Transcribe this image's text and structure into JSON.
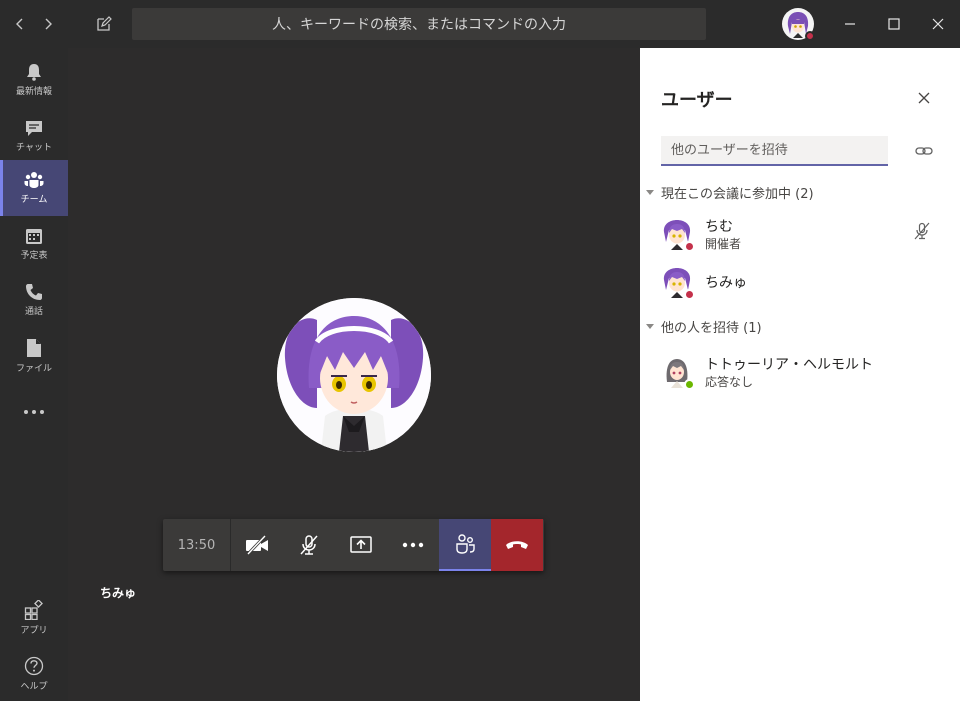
{
  "titlebar": {
    "search_placeholder": "人、キーワードの検索、またはコマンドの入力"
  },
  "rail": {
    "items": [
      {
        "label": "最新情報",
        "icon": "bell-icon"
      },
      {
        "label": "チャット",
        "icon": "chat-icon"
      },
      {
        "label": "チーム",
        "icon": "teams-icon",
        "active": true
      },
      {
        "label": "予定表",
        "icon": "calendar-icon"
      },
      {
        "label": "通話",
        "icon": "phone-icon"
      },
      {
        "label": "ファイル",
        "icon": "file-icon"
      },
      {
        "label": "",
        "icon": "more-icon"
      }
    ],
    "bottom": [
      {
        "label": "アプリ",
        "icon": "apps-icon"
      },
      {
        "label": "ヘルプ",
        "icon": "help-icon"
      }
    ]
  },
  "call": {
    "timer": "13:50",
    "caller_name": "ちみゅ"
  },
  "panel": {
    "title": "ユーザー",
    "invite_placeholder": "他のユーザーを招待",
    "in_meeting_header": "現在この会議に参加中 (2)",
    "invited_header": "他の人を招待 (1)",
    "participants": [
      {
        "name": "ちむ",
        "role": "開催者",
        "status_color": "#c4314b",
        "muted": true
      },
      {
        "name": "ちみゅ",
        "role": "",
        "status_color": "#c4314b",
        "muted": false
      }
    ],
    "invited": [
      {
        "name": "トトゥーリア・ヘルモルト",
        "status": "応答なし",
        "status_color": "#6bb700"
      }
    ]
  },
  "colors": {
    "accent": "#6264a7",
    "hangup": "#a4262c",
    "busy": "#c4314b",
    "available": "#6bb700"
  }
}
